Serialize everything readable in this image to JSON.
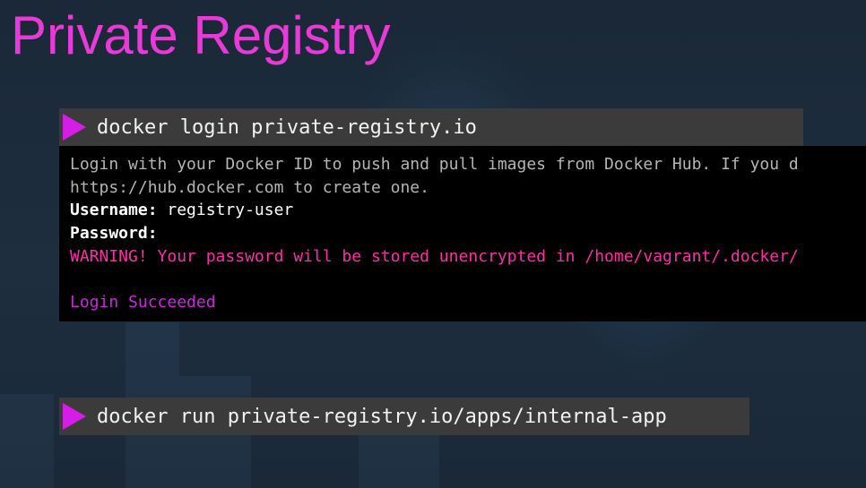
{
  "slide": {
    "title": "Private Registry"
  },
  "login_command": {
    "icon": "play-triangle-icon",
    "text": "docker login private-registry.io"
  },
  "terminal_output": {
    "line1": "Login with your Docker ID to push and pull images from Docker Hub. If you d",
    "line2": "https://hub.docker.com to create one.",
    "username_label": "Username:",
    "username_value": " registry-user",
    "password_label": "Password:",
    "warning": "WARNING! Your password will be stored unencrypted in /home/vagrant/.docker/",
    "success": "Login Succeeded"
  },
  "run_command": {
    "icon": "play-triangle-icon",
    "text": "docker run private-registry.io/apps/internal-app"
  },
  "colors": {
    "title": "#e83ad6",
    "triangle": "#d41ee6",
    "warning": "#ff2ea6",
    "success": "#c72ad8",
    "background": "#1b2838"
  }
}
